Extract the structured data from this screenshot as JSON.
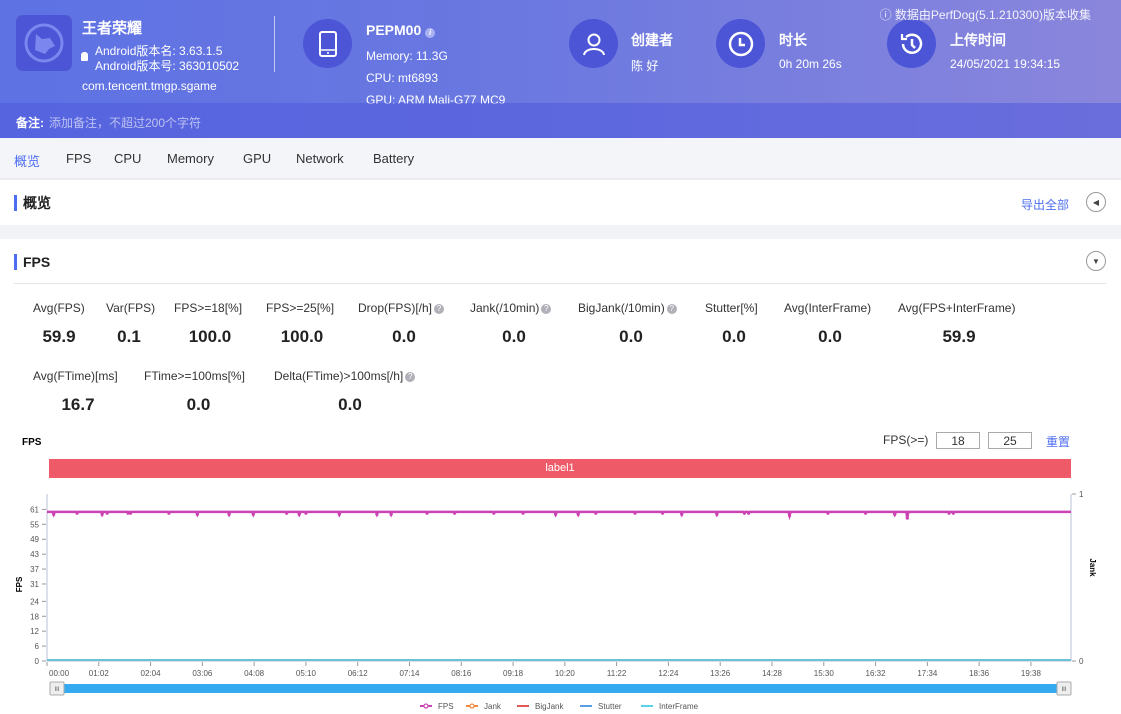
{
  "app": {
    "name": "王者荣耀",
    "version_name": "Android版本名: 3.63.1.5",
    "version_code": "Android版本号: 363010502",
    "package": "com.tencent.tmgp.sgame",
    "icon": "fox-app-icon"
  },
  "device": {
    "model": "PEPM00",
    "memory": "Memory: 11.3G",
    "cpu": "CPU: mt6893",
    "gpu": "GPU: ARM Mali-G77 MC9",
    "icon": "phone-icon"
  },
  "creator": {
    "title": "创建者",
    "value": "陈 好",
    "icon": "user-icon"
  },
  "duration": {
    "title": "时长",
    "value": "0h 20m 26s",
    "icon": "clock-icon"
  },
  "upload": {
    "title": "上传时间",
    "value": "24/05/2021 19:34:15",
    "icon": "history-icon"
  },
  "collected_by": "数据由PerfDog(5.1.210300)版本收集",
  "note": {
    "label": "备注:",
    "placeholder": "添加备注，不超过200个字符"
  },
  "tabs": [
    {
      "label": "概览",
      "active": true
    },
    {
      "label": "FPS"
    },
    {
      "label": "CPU"
    },
    {
      "label": "Memory"
    },
    {
      "label": "GPU"
    },
    {
      "label": "Network"
    },
    {
      "label": "Battery"
    }
  ],
  "overview": {
    "title": "概览",
    "export": "导出全部"
  },
  "fps_section": {
    "title": "FPS",
    "metrics_row1": [
      {
        "label": "Avg(FPS)",
        "value": "59.9"
      },
      {
        "label": "Var(FPS)",
        "value": "0.1"
      },
      {
        "label": "FPS>=18[%]",
        "value": "100.0"
      },
      {
        "label": "FPS>=25[%]",
        "value": "100.0"
      },
      {
        "label": "Drop(FPS)[/h]",
        "value": "0.0",
        "help": true
      },
      {
        "label": "Jank(/10min)",
        "value": "0.0",
        "help": true
      },
      {
        "label": "BigJank(/10min)",
        "value": "0.0",
        "help": true
      },
      {
        "label": "Stutter[%]",
        "value": "0.0"
      },
      {
        "label": "Avg(InterFrame)",
        "value": "0.0"
      },
      {
        "label": "Avg(FPS+InterFrame)",
        "value": "59.9"
      }
    ],
    "metrics_row2": [
      {
        "label": "Avg(FTime)[ms]",
        "value": "16.7"
      },
      {
        "label": "FTime>=100ms[%]",
        "value": "0.0"
      },
      {
        "label": "Delta(FTime)>100ms[/h]",
        "value": "0.0",
        "help": true
      }
    ],
    "threshold_label": "FPS(>=)",
    "threshold_1": "18",
    "threshold_2": "25",
    "reset": "重置"
  },
  "chart_data": {
    "type": "line",
    "title": "FPS",
    "label_bar": "label1",
    "ylabel": "FPS",
    "y2label": "Jank",
    "y_ticks": [
      0,
      6,
      12,
      18,
      24,
      31,
      37,
      43,
      49,
      55,
      61
    ],
    "ylim": [
      0,
      66
    ],
    "y2_ticks": [
      0,
      1
    ],
    "x_ticks": [
      "00:00",
      "01:02",
      "02:04",
      "03:06",
      "04:08",
      "05:10",
      "06:12",
      "07:14",
      "08:16",
      "09:18",
      "10:20",
      "11:22",
      "12:24",
      "13:26",
      "14:28",
      "15:30",
      "16:32",
      "17:34",
      "18:36",
      "19:38"
    ],
    "x_range_seconds": [
      0,
      1226
    ],
    "series": [
      {
        "name": "FPS",
        "color": "#cc44b4",
        "baseline": 60,
        "dips": [
          {
            "t": 8,
            "v": 59
          },
          {
            "t": 36,
            "v": 59.5
          },
          {
            "t": 66,
            "v": 59
          },
          {
            "t": 72,
            "v": 59.5
          },
          {
            "t": 97,
            "v": 59.5
          },
          {
            "t": 100,
            "v": 59.5
          },
          {
            "t": 146,
            "v": 59.5
          },
          {
            "t": 180,
            "v": 59
          },
          {
            "t": 218,
            "v": 59
          },
          {
            "t": 247,
            "v": 59
          },
          {
            "t": 287,
            "v": 59.5
          },
          {
            "t": 302,
            "v": 59
          },
          {
            "t": 310,
            "v": 59.5
          },
          {
            "t": 350,
            "v": 59
          },
          {
            "t": 395,
            "v": 59
          },
          {
            "t": 412,
            "v": 59
          },
          {
            "t": 455,
            "v": 59.5
          },
          {
            "t": 488,
            "v": 59.5
          },
          {
            "t": 535,
            "v": 59.5
          },
          {
            "t": 570,
            "v": 59.5
          },
          {
            "t": 609,
            "v": 59
          },
          {
            "t": 636,
            "v": 59
          },
          {
            "t": 657,
            "v": 59.5
          },
          {
            "t": 704,
            "v": 59.5
          },
          {
            "t": 737,
            "v": 59.5
          },
          {
            "t": 760,
            "v": 59
          },
          {
            "t": 802,
            "v": 59
          },
          {
            "t": 835,
            "v": 59.5
          },
          {
            "t": 840,
            "v": 59.5
          },
          {
            "t": 889,
            "v": 58.5
          },
          {
            "t": 935,
            "v": 59.5
          },
          {
            "t": 980,
            "v": 59.5
          },
          {
            "t": 1015,
            "v": 59
          },
          {
            "t": 1030,
            "v": 57.5
          },
          {
            "t": 1080,
            "v": 59.5
          },
          {
            "t": 1085,
            "v": 59.5
          }
        ]
      },
      {
        "name": "Jank",
        "color": "#f08a3c",
        "values": "all 0"
      },
      {
        "name": "BigJank",
        "color": "#e05a5a",
        "values": "all 0"
      },
      {
        "name": "Stutter",
        "color": "#5a9be6",
        "values": "all 0"
      },
      {
        "name": "InterFrame",
        "color": "#5ad2e6",
        "values": "all 0"
      }
    ],
    "legend": [
      "FPS",
      "Jank",
      "BigJank",
      "Stutter",
      "InterFrame"
    ],
    "legend_position": "bottom",
    "grid": false
  }
}
